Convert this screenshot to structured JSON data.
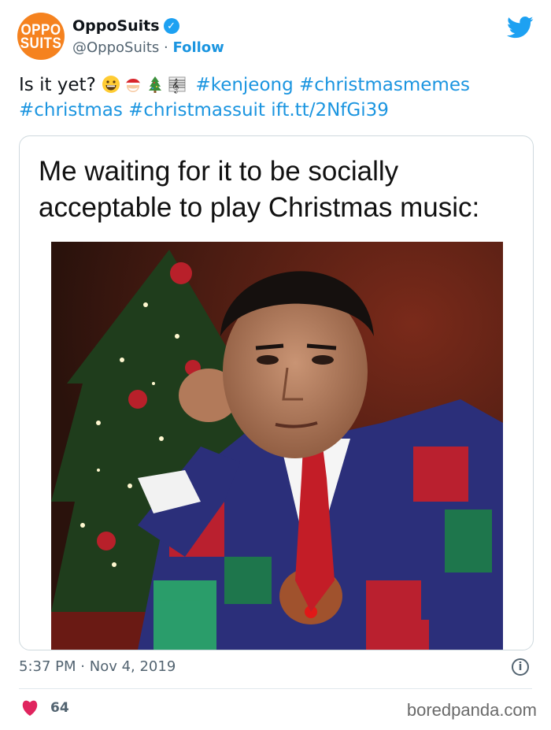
{
  "account": {
    "avatar_line1": "OPPO",
    "avatar_line2": "SUITS",
    "name": "OppoSuits",
    "handle": "@OppoSuits",
    "separator": "·",
    "follow_label": "Follow",
    "verified_icon": "verified-badge-icon",
    "platform_icon": "twitter-bird-icon"
  },
  "tweet": {
    "text_start": "Is it yet?",
    "emojis": [
      "grinning-face-emoji",
      "santa-emoji",
      "christmas-tree-emoji",
      "musical-score-emoji"
    ],
    "hashtags": [
      "#kenjeong",
      "#christmasmemes",
      "#christmas",
      "#christmassuit"
    ],
    "link": "ift.tt/2NfGi39"
  },
  "media": {
    "caption": "Me waiting for it to be socially acceptable to play Christmas music:"
  },
  "meta": {
    "time": "5:37 PM",
    "separator": "·",
    "date": "Nov 4, 2019",
    "info_icon": "info-icon"
  },
  "engagement": {
    "likes": "64",
    "like_icon": "heart-icon"
  },
  "watermark": "boredpanda.com",
  "colors": {
    "link": "#1b95e0",
    "brand": "#f5821f",
    "heart": "#e0245e",
    "verified": "#1da1f2"
  }
}
